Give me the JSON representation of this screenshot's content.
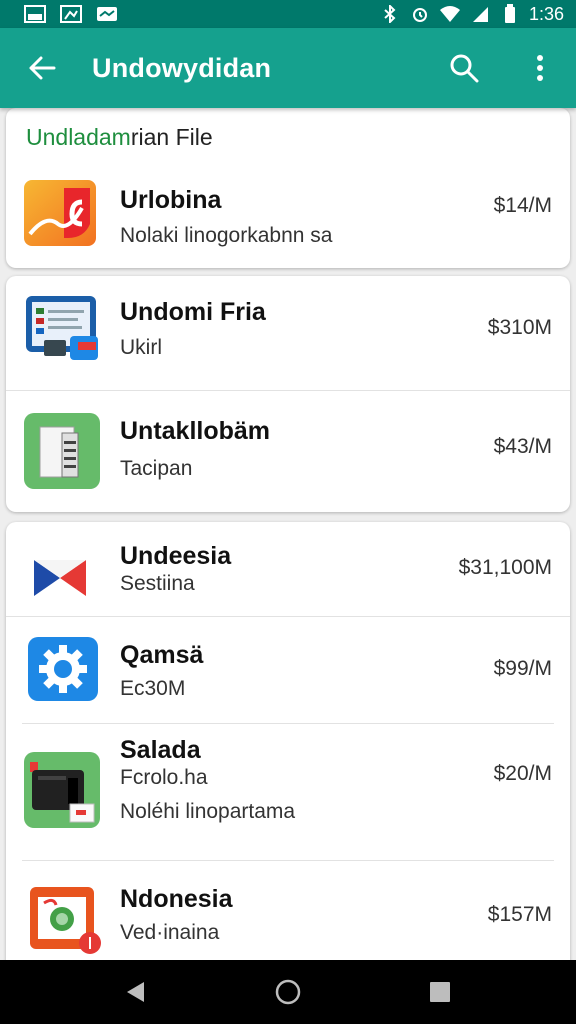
{
  "app_bar": {
    "title": "Undowydidan"
  },
  "status_bar": {
    "time": "1:36"
  },
  "section": {
    "title_accent": "Undladam",
    "title_rest": "rian File"
  },
  "items": [
    {
      "name": "Urlobina",
      "sub": "Nolaki linogorkabnn sa",
      "price": "$14/M",
      "icon": "app-icon-orange"
    },
    {
      "name": "Undomi Fria",
      "sub": "Ukirl",
      "price": "$310M",
      "icon": "app-icon-tablet"
    },
    {
      "name": "Untakllobäm",
      "sub": "Tacipan",
      "price": "$43/M",
      "icon": "app-icon-server"
    },
    {
      "name": "Undeesia",
      "sub": "Sestiina",
      "price": "$31,100M",
      "icon": "app-icon-flag"
    },
    {
      "name": "Qamsä",
      "sub": "Ec30M",
      "price": "$99/M",
      "icon": "gear-icon"
    },
    {
      "name": "Salada",
      "sub": "Fcrolo.ha",
      "sub2": "Noléhi linopartama",
      "price": "$20/M",
      "icon": "app-icon-printer"
    },
    {
      "name": "Ndonesia",
      "sub": "Ved·inaina",
      "price": "$157M",
      "icon": "app-icon-photo"
    }
  ],
  "colors": {
    "status_bar": "#00796b",
    "app_bar": "#15a18e",
    "accent_green": "#1e8e3e"
  }
}
